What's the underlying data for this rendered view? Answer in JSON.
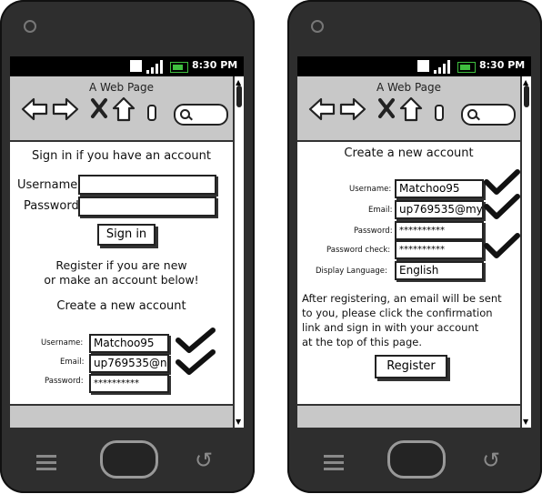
{
  "status_bar": {
    "time": "8:30 PM"
  },
  "browser": {
    "page_title": "A Web Page"
  },
  "left_screen": {
    "signin_heading": "Sign in if you have an account",
    "username_label": "Username:",
    "password_label": "Password:",
    "signin_button": "Sign in",
    "register_text_line1": "Register if you are new",
    "register_text_line2": "or make an account below!",
    "create_heading": "Create a new account",
    "reg_username_label": "Username:",
    "reg_username_value": "Matchoo95",
    "reg_email_label": "Email:",
    "reg_email_value": "up769535@n",
    "reg_password_label": "Password:",
    "reg_password_value": "**********"
  },
  "right_screen": {
    "create_heading": "Create a new account",
    "username_label": "Username:",
    "username_value": "Matchoo95",
    "email_label": "Email:",
    "email_value": "up769535@my",
    "password_label": "Password:",
    "password_value": "**********",
    "password_check_label": "Password check:",
    "password_check_value": "**********",
    "language_label": "Display Language:",
    "language_value": "English",
    "info_line1": "After registering, an email will be sent",
    "info_line2": "to you, please click the confirmation",
    "info_line3": "link and sign in with your account",
    "info_line4": "at the top of this page.",
    "register_button": "Register"
  }
}
